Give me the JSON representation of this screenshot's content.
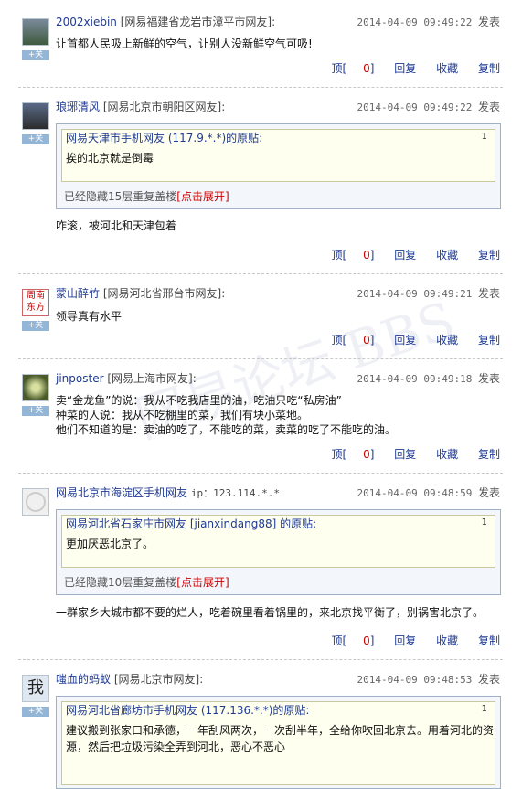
{
  "follow_label": "+关",
  "actions": {
    "top": "顶",
    "reply": "回复",
    "collect": "收藏",
    "copy": "复制"
  },
  "posts": [
    {
      "user": "2002xiebin",
      "location": "[网易福建省龙岩市漳平市网友]:",
      "time": "2014-04-09 09:49:22",
      "published": "发表",
      "body": "让首都人民吸上新鲜的空气，让别人没新鲜空气可吸!",
      "top_count": "0"
    },
    {
      "user": "琅琊清风",
      "location": "[网易北京市朝阳区网友]:",
      "time": "2014-04-09 09:49:22",
      "published": "发表",
      "quote_head": "网易天津市手机网友 (117.9.*.*)的原贴:",
      "quote_num": "1",
      "quote_text": "挨的北京就是倒霉",
      "hidden_prefix": "已经隐藏15层重复盖楼",
      "hidden_expand": "[点击展开]",
      "body": "咋滚，被河北和天津包着",
      "top_count": "0"
    },
    {
      "user": "蒙山醉竹",
      "location": "[网易河北省邢台市网友]:",
      "time": "2014-04-09 09:49:21",
      "published": "发表",
      "body": "领导真有水平",
      "top_count": "0"
    },
    {
      "user": "jinposter",
      "location": "[网易上海市网友]:",
      "time": "2014-04-09 09:49:18",
      "published": "发表",
      "body_lines": [
        "卖“金龙鱼”的说：我从不吃我店里的油，吃油只吃“私房油”",
        "种菜的人说：我从不吃棚里的菜，我们有块小菜地。",
        "他们不知道的是：卖油的吃了，不能吃的菜，卖菜的吃了不能吃的油。"
      ],
      "top_count": "0"
    },
    {
      "user": "网易北京市海淀区手机网友",
      "location": "ip：123.114.*.*",
      "time": "2014-04-09 09:48:59",
      "published": "发表",
      "quote_head": "网易河北省石家庄市网友 [jianxindang88] 的原贴:",
      "quote_num": "1",
      "quote_text": "更加厌恶北京了。",
      "hidden_prefix": "已经隐藏10层重复盖楼",
      "hidden_expand": "[点击展开]",
      "body": "一群家乡大城市都不要的烂人，吃着碗里看着锅里的，来北京找平衡了，别祸害北京了。",
      "top_count": "0"
    },
    {
      "user": "嗤血的蚂蚁",
      "location": "[网易北京市网友]:",
      "time": "2014-04-09 09:48:53",
      "published": "发表",
      "quote_head": "网易河北省廊坊市手机网友 (117.136.*.*)的原贴:",
      "quote_num": "1",
      "quote_lines": [
        "建议搬到张家口和承德，一年刮风两次，一次刮半年，全给你吹回北京去。用着河北的资",
        "源，然后把垃圾污染全弄到河北，恶心不恶心"
      ]
    }
  ],
  "watermark": "网易论坛 BBS"
}
